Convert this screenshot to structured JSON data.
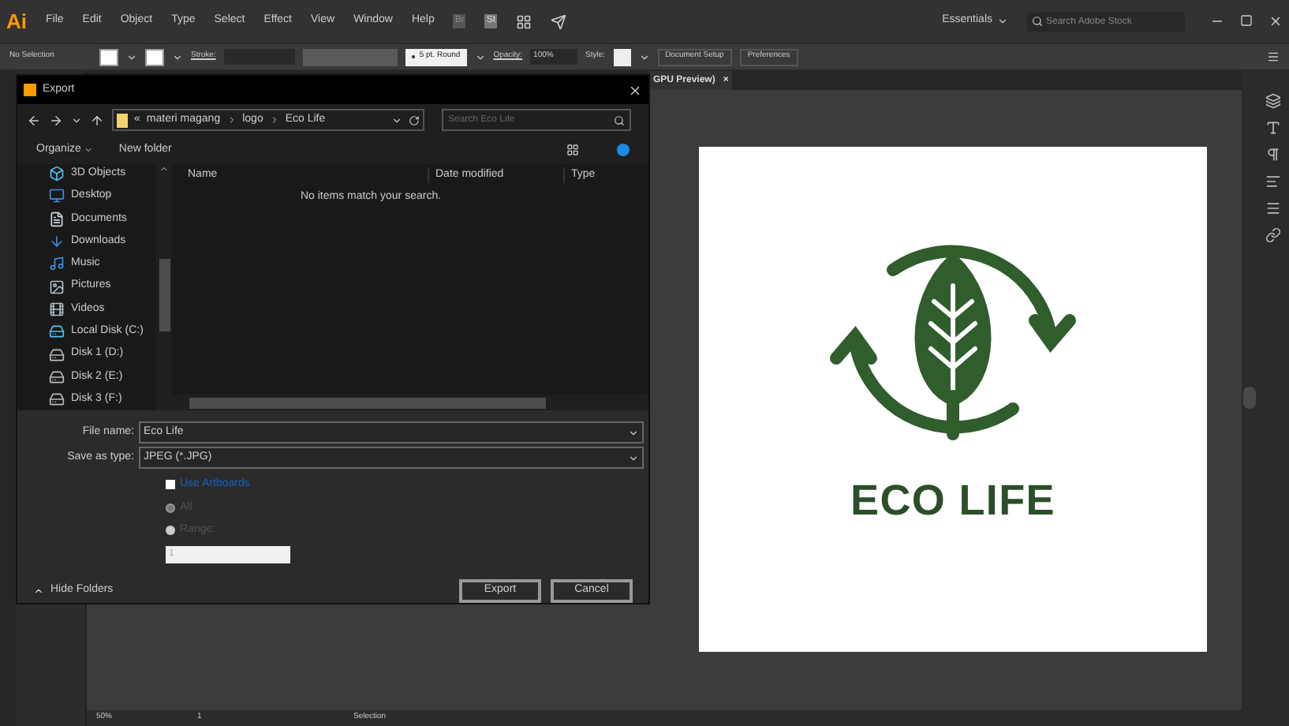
{
  "app": {
    "logo": "Ai",
    "menu": [
      "File",
      "Edit",
      "Object",
      "Type",
      "Select",
      "Effect",
      "View",
      "Window",
      "Help"
    ],
    "bridge_badges": [
      "Br",
      "St"
    ],
    "workspace": "Essentials",
    "search": {
      "placeholder": "Search Adobe Stock"
    }
  },
  "options_bar": {
    "selection": "No Selection",
    "stroke_label": "Stroke:",
    "brush": "5 pt. Round",
    "opacity_label": "Opacity:",
    "opacity": "100%",
    "style_label": "Style:",
    "buttons": [
      "Document Setup",
      "Preferences"
    ]
  },
  "document_tab": {
    "title": "GPU Preview)",
    "close": "×"
  },
  "artboard": {
    "logo_text": "ECO LIFE"
  },
  "status_bar": {
    "zoom": "50%",
    "artboard": "1",
    "tool": "Selection"
  },
  "dialog": {
    "title": "Export",
    "path_prefix": "«",
    "path": [
      "materi magang",
      "logo",
      "Eco Life"
    ],
    "search": {
      "placeholder": "Search Eco Life"
    },
    "organize": "Organize",
    "new_folder": "New folder",
    "nav": [
      {
        "kind": "cube",
        "name": "3D Objects"
      },
      {
        "kind": "desktop",
        "name": "Desktop"
      },
      {
        "kind": "document",
        "name": "Documents"
      },
      {
        "kind": "download",
        "name": "Downloads"
      },
      {
        "kind": "music",
        "name": "Music"
      },
      {
        "kind": "picture",
        "name": "Pictures"
      },
      {
        "kind": "video",
        "name": "Videos"
      },
      {
        "kind": "system",
        "name": "Local Disk (C:)"
      },
      {
        "kind": "disk",
        "name": "Disk 1 (D:)"
      },
      {
        "kind": "disk",
        "name": "Disk 2 (E:)"
      },
      {
        "kind": "disk",
        "name": "Disk 3 (F:)"
      }
    ],
    "columns": [
      "Name",
      "Date modified",
      "Type"
    ],
    "empty_message": "No items match your search.",
    "file_name": {
      "label": "File name:",
      "value": "Eco Life"
    },
    "save_as_type": {
      "label": "Save as type:",
      "value": "JPEG (*.JPG)"
    },
    "use_artboards": {
      "label": "Use Artboards",
      "checked": false
    },
    "radios": [
      {
        "label": "All",
        "selected": true
      },
      {
        "label": "Range:",
        "selected": false
      }
    ],
    "range_value": "1",
    "hide_folders": "Hide Folders",
    "buttons": [
      "Export",
      "Cancel"
    ]
  }
}
